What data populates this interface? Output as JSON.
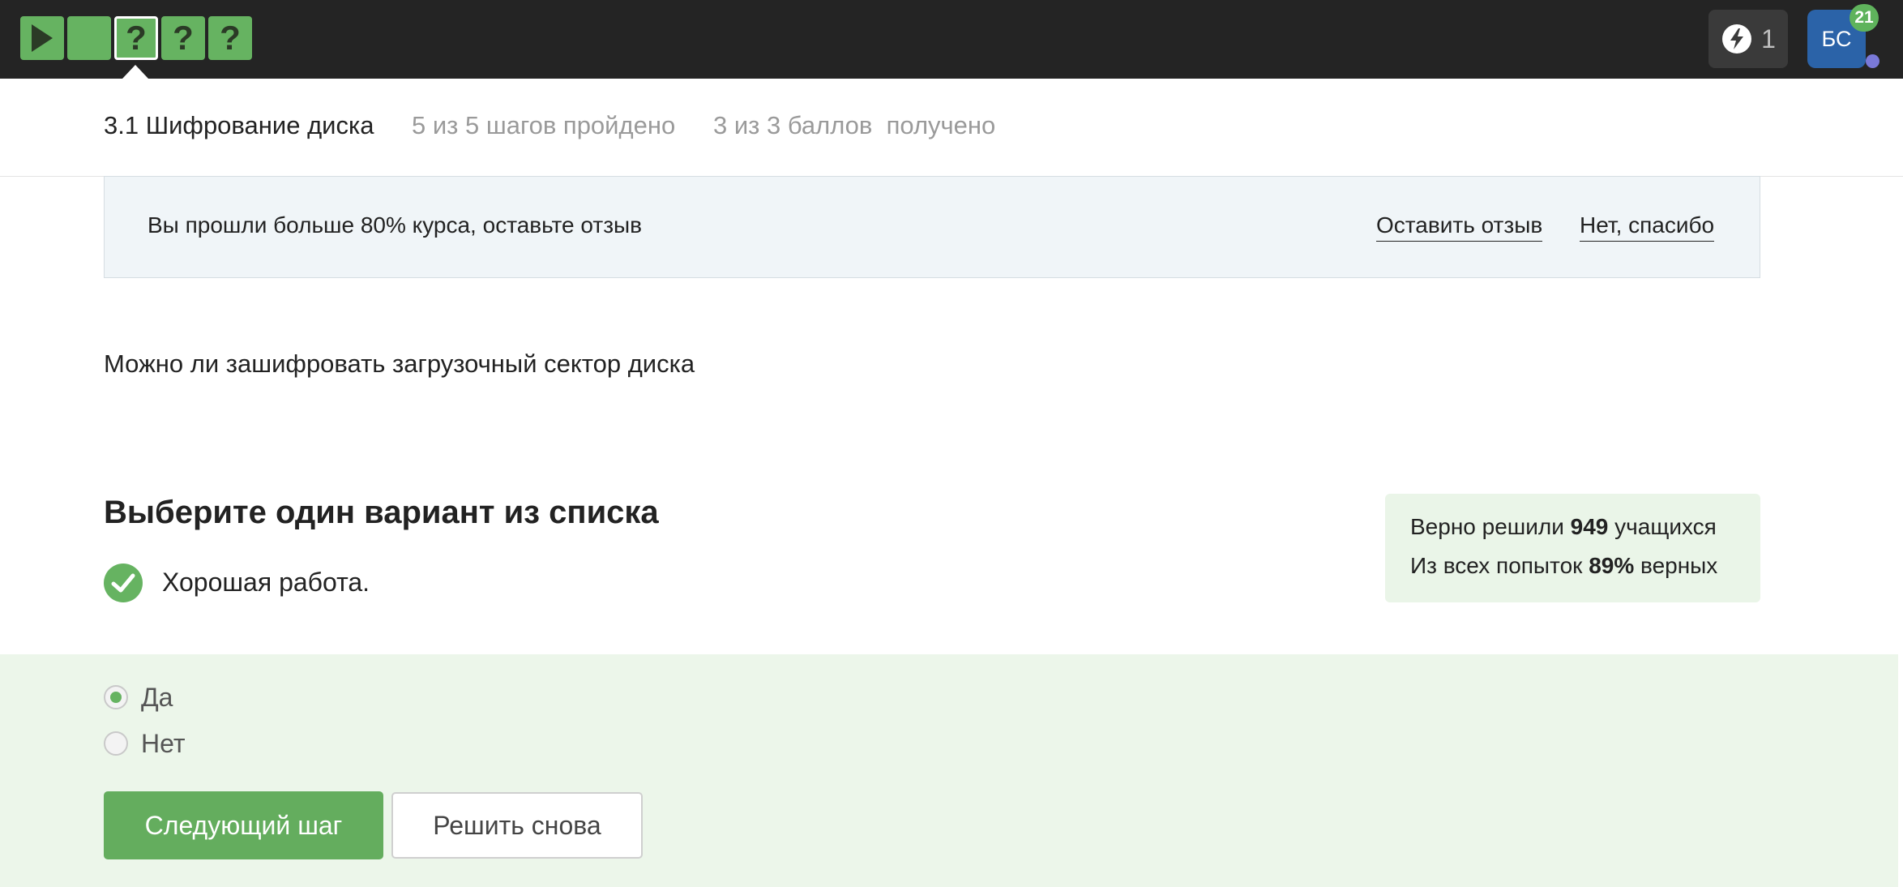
{
  "topbar": {
    "steps": [
      {
        "icon": "play-icon",
        "state": "solved"
      },
      {
        "icon": "blank",
        "state": "solved"
      },
      {
        "label": "?",
        "state": "current"
      },
      {
        "label": "?",
        "state": "solved"
      },
      {
        "label": "?",
        "state": "solved"
      }
    ],
    "energy": {
      "icon": "lightning-icon",
      "count": "1"
    },
    "avatar": {
      "initials": "БС",
      "notifications": "21"
    }
  },
  "lesson": {
    "title": "3.1 Шифрование диска",
    "progress": "5 из 5 шагов пройдено",
    "score": "3 из 3 баллов  получено"
  },
  "feedback": {
    "text": "Вы прошли больше 80% курса, оставьте отзыв",
    "leave_review": "Оставить отзыв",
    "no_thanks": "Нет, спасибо"
  },
  "question": {
    "text": "Можно ли зашифровать загрузочный сектор диска",
    "instruction": "Выберите один вариант из списка",
    "result": "Хорошая работа."
  },
  "stats": {
    "solved_prefix": "Верно решили",
    "solved_count": "949",
    "solved_suffix": "учащихся",
    "attempts_prefix": "Из всех попыток",
    "attempts_percent": "89%",
    "attempts_suffix": "верных"
  },
  "options": [
    {
      "label": "Да",
      "selected": true
    },
    {
      "label": "Нет",
      "selected": false
    }
  ],
  "actions": {
    "next": "Следующий шаг",
    "retry": "Решить снова"
  },
  "colors": {
    "accent_green": "#66b361",
    "topbar": "#242424",
    "avatar_blue": "#2b63a8",
    "answer_bg": "#ecf6ea"
  }
}
